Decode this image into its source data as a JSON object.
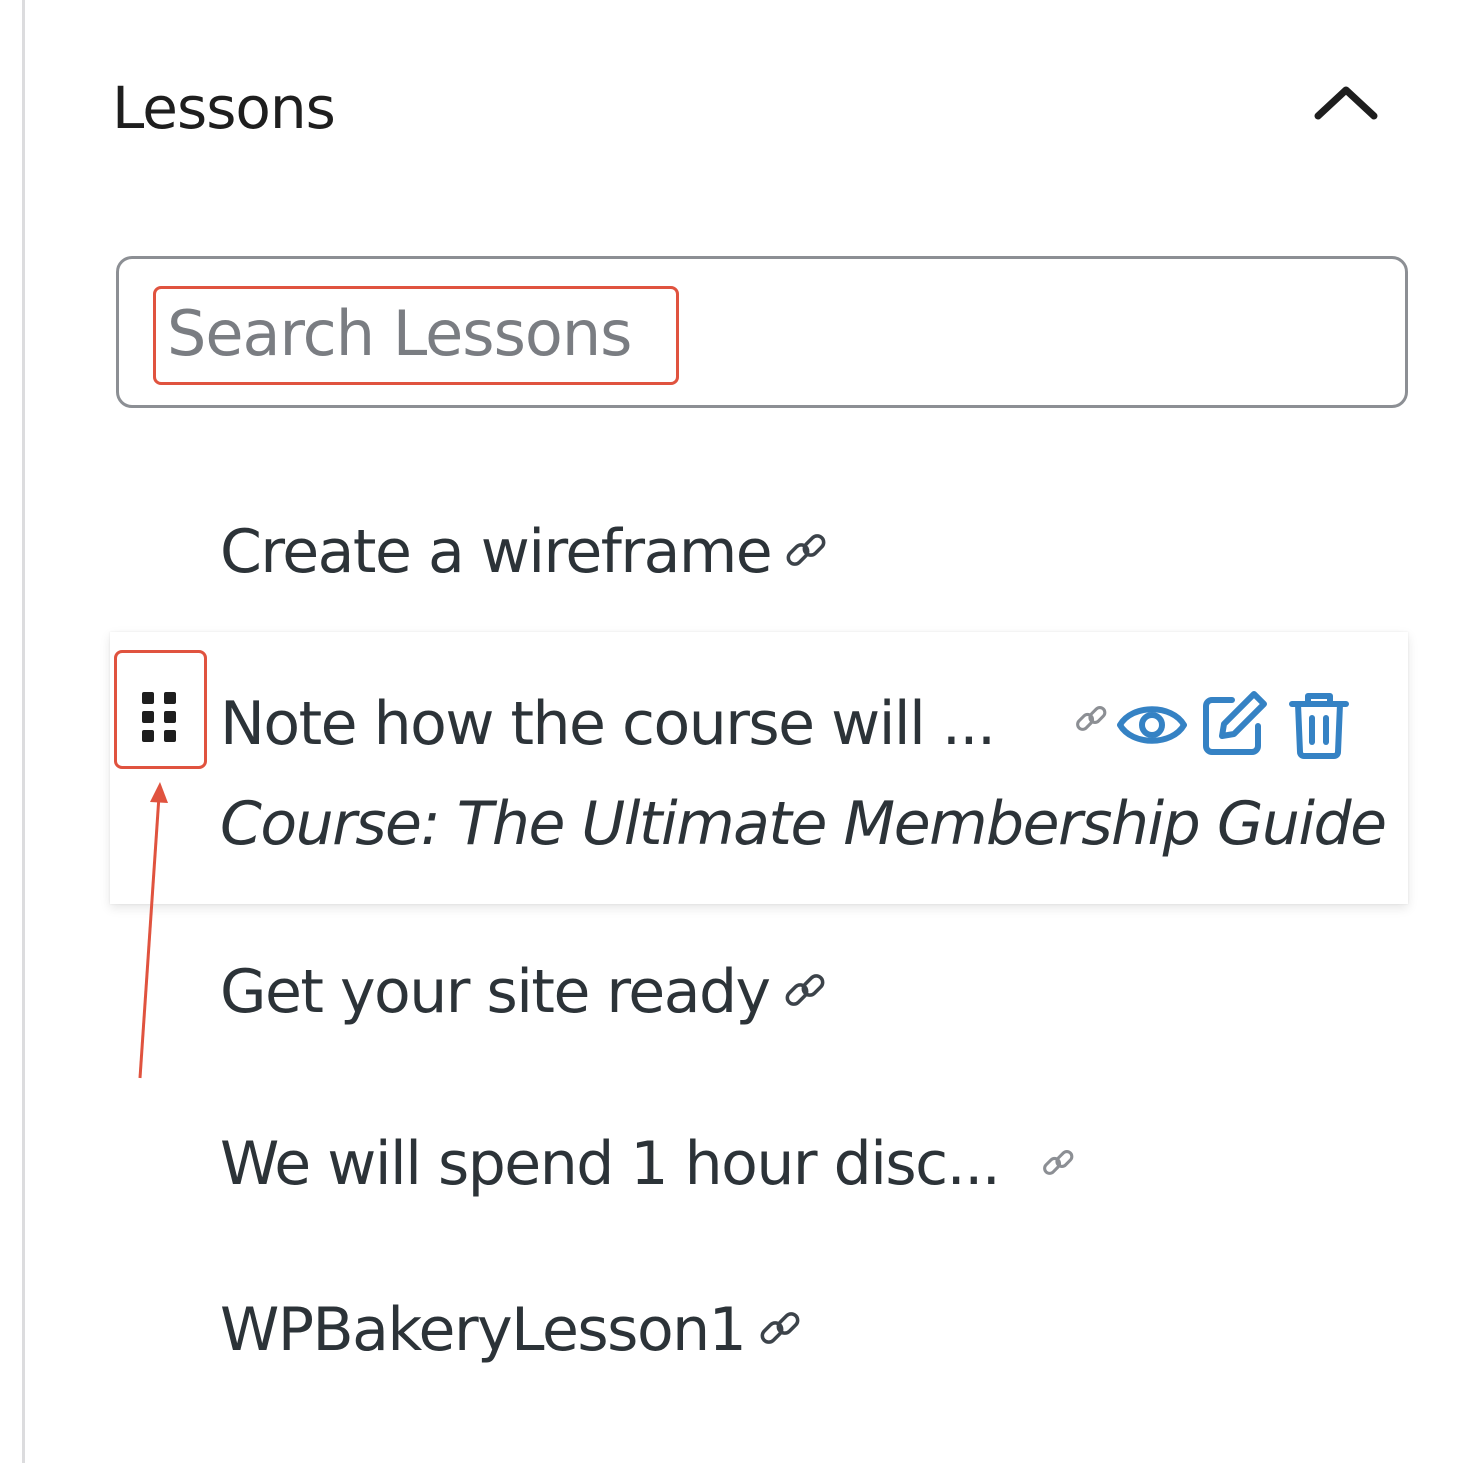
{
  "panel": {
    "title": "Lessons",
    "collapse_icon": "chevron-up-icon"
  },
  "search": {
    "placeholder": "Search Lessons",
    "value": ""
  },
  "lessons": [
    {
      "title": "Create a wireframe",
      "icon": "link-icon"
    },
    {
      "title": "Note how the course will ...",
      "course": "Course: The Ultimate Membership Guide",
      "icons": [
        "drag-handle-icon",
        "link-icon",
        "eye-icon",
        "edit-icon",
        "trash-icon"
      ]
    },
    {
      "title": "Get your site ready",
      "icon": "link-icon"
    },
    {
      "title": "We will spend 1 hour disc...",
      "icon": "link-icon"
    },
    {
      "title": "WPBakeryLesson1",
      "icon": "link-icon"
    }
  ],
  "colors": {
    "action_blue": "#3582c4",
    "annotation_red": "#e0533f",
    "text": "#2c3338",
    "border": "#8c8f94"
  }
}
